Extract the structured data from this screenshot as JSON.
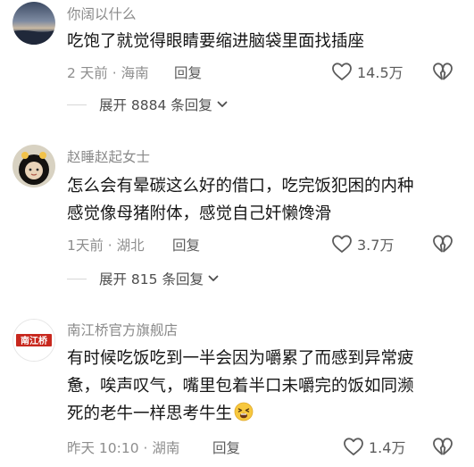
{
  "comments": [
    {
      "username": "你阔以什么",
      "content_lines": [
        "吃饱了就觉得眼睛要缩进脑袋里面找插座"
      ],
      "time_location": "2 天前 · 海南",
      "reply_label": "回复",
      "likes": "14.5万",
      "expand_label": "展开 8884 条回复"
    },
    {
      "username": "赵睡赵起女士",
      "content_lines": [
        "怎么会有晕碳这么好的借口，吃完饭犯困的内种",
        "感觉像母猪附体，感觉自己奸懒馋滑"
      ],
      "time_location": "1天前 · 湖北",
      "reply_label": "回复",
      "likes": "3.7万",
      "expand_label": "展开 815 条回复"
    },
    {
      "username": "南江桥官方旗舰店",
      "avatar_text": "南江桥",
      "content_lines": [
        "有时候吃饭吃到一半会因为嚼累了而感到异常疲",
        "惫，唉声叹气，嘴里包着半口未嚼完的饭如同濒",
        "死的老牛一样思考牛生"
      ],
      "time_location": "昨天 10:10 · 湖南",
      "reply_label": "回复",
      "likes": "1.4万"
    }
  ],
  "icons": {
    "like": "heart-outline-icon",
    "dislike": "broken-heart-icon",
    "expand": "chevron-down-icon",
    "emoji": "tired-face-emoji-icon"
  },
  "colors": {
    "brand_red": "#c8281e",
    "text_primary": "#161616",
    "text_secondary": "#8e8e8e"
  }
}
